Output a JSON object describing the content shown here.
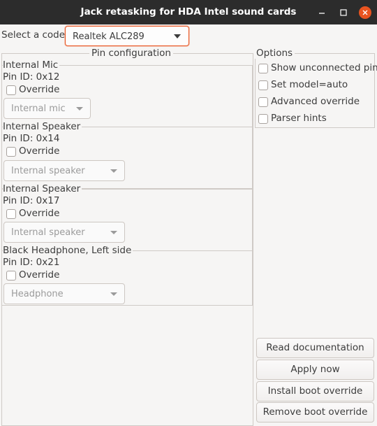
{
  "window": {
    "title": "Jack retasking for HDA Intel sound cards"
  },
  "codec": {
    "label": "Select a codec:",
    "value": "Realtek ALC289"
  },
  "pin_config": {
    "title": "Pin configuration",
    "override_label": "Override",
    "pins": [
      {
        "name": "Internal Mic",
        "id": "Pin ID: 0x12",
        "combo": "Internal mic"
      },
      {
        "name": "Internal Speaker",
        "id": "Pin ID: 0x14",
        "combo": "Internal speaker"
      },
      {
        "name": "Internal Speaker",
        "id": "Pin ID: 0x17",
        "combo": "Internal speaker"
      },
      {
        "name": "Black Headphone, Left side",
        "id": "Pin ID: 0x21",
        "combo": "Headphone"
      }
    ]
  },
  "options": {
    "title": "Options",
    "items": [
      "Show unconnected pins",
      "Set model=auto",
      "Advanced override",
      "Parser hints"
    ]
  },
  "actions": {
    "read_docs": "Read documentation",
    "apply_now": "Apply now",
    "install_boot": "Install boot override",
    "remove_boot": "Remove boot override"
  },
  "colors": {
    "accent": "#e95420",
    "titlebar": "#2c2c2c",
    "background": "#f6f5f4"
  },
  "icons": {
    "minimize": "minimize-icon",
    "maximize": "maximize-icon",
    "close": "close-icon"
  }
}
